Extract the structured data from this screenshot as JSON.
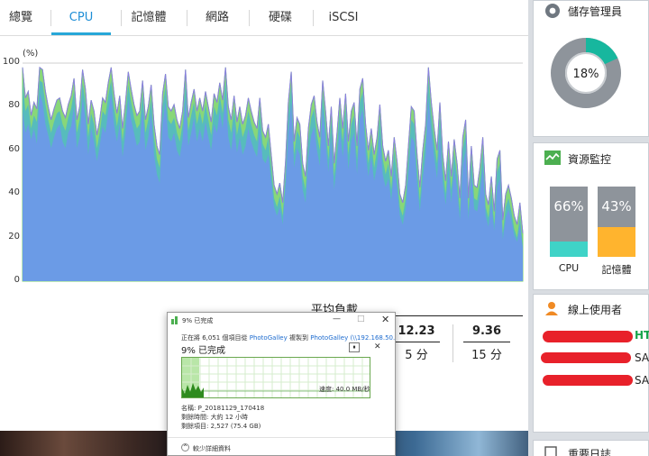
{
  "tabs": [
    {
      "label": "總覽",
      "active": false
    },
    {
      "label": "CPU",
      "active": true
    },
    {
      "label": "記憶體",
      "active": false
    },
    {
      "label": "網路",
      "active": false
    },
    {
      "label": "硬碟",
      "active": false
    },
    {
      "label": "iSCSI",
      "active": false
    }
  ],
  "chart": {
    "unit_label": "(%)",
    "y_ticks": [
      "0",
      "20",
      "40",
      "60",
      "80",
      "100"
    ],
    "colors": {
      "lower": "#6b9be6",
      "mid": "#4fb7c8",
      "top": "#7bd36a",
      "upper_stroke": "#8a7fe0"
    }
  },
  "chart_data": {
    "type": "area",
    "ylabel": "(%)",
    "ylim": [
      0,
      100
    ],
    "grid": false,
    "series": [
      {
        "values": [
          98,
          84,
          87,
          76,
          82,
          79,
          98,
          97,
          87,
          80,
          74,
          79,
          83,
          84,
          78,
          75,
          81,
          85,
          93,
          74,
          80,
          97,
          88,
          72,
          83,
          78,
          67,
          74,
          84,
          82,
          91,
          98,
          86,
          77,
          85,
          70,
          82,
          96,
          88,
          81,
          76,
          78,
          92,
          74,
          80,
          90,
          72,
          62,
          58,
          86,
          95,
          80,
          78,
          81,
          74,
          70,
          78,
          97,
          75,
          82,
          88,
          78,
          84,
          78,
          87,
          80,
          73,
          86,
          82,
          91,
          83,
          98,
          80,
          74,
          85,
          73,
          80,
          72,
          76,
          84,
          78,
          73,
          70,
          84,
          69,
          66,
          72,
          58,
          44,
          40,
          45,
          36,
          55,
          82,
          96,
          64,
          75,
          72,
          54,
          48,
          70,
          81,
          85,
          73,
          66,
          92,
          78,
          62,
          80,
          54,
          68,
          84,
          70,
          86,
          64,
          78,
          82,
          62,
          88,
          93,
          72,
          60,
          70,
          58,
          66,
          81,
          62,
          55,
          60,
          48,
          66,
          55,
          40,
          36,
          44,
          62,
          80,
          78,
          58,
          43,
          60,
          72,
          98,
          82,
          70,
          60,
          82,
          58,
          46,
          64,
          48,
          65,
          54,
          38,
          66,
          74,
          38,
          62,
          44,
          43,
          52,
          66,
          40,
          35,
          48,
          32,
          56,
          60,
          28,
          40,
          44,
          38,
          30,
          26,
          36,
          22
        ]
      },
      {
        "values": [
          78,
          68,
          72,
          65,
          70,
          63,
          86,
          82,
          72,
          67,
          61,
          66,
          70,
          72,
          64,
          61,
          68,
          71,
          80,
          61,
          66,
          84,
          74,
          58,
          70,
          64,
          55,
          62,
          71,
          68,
          78,
          86,
          72,
          64,
          72,
          57,
          68,
          83,
          74,
          68,
          62,
          64,
          79,
          60,
          66,
          77,
          58,
          49,
          45,
          72,
          82,
          66,
          64,
          68,
          60,
          57,
          65,
          84,
          62,
          68,
          75,
          64,
          70,
          64,
          73,
          66,
          60,
          72,
          68,
          78,
          70,
          85,
          66,
          60,
          72,
          59,
          66,
          58,
          62,
          70,
          64,
          60,
          57,
          70,
          56,
          54,
          58,
          46,
          34,
          30,
          34,
          26,
          44,
          68,
          82,
          52,
          61,
          58,
          42,
          36,
          57,
          67,
          71,
          60,
          53,
          79,
          64,
          50,
          66,
          42,
          55,
          70,
          57,
          72,
          51,
          64,
          68,
          49,
          74,
          79,
          59,
          48,
          57,
          46,
          53,
          67,
          49,
          43,
          47,
          37,
          52,
          43,
          30,
          26,
          33,
          49,
          66,
          64,
          45,
          32,
          47,
          58,
          84,
          68,
          57,
          47,
          68,
          45,
          35,
          51,
          36,
          52,
          42,
          28,
          53,
          60,
          28,
          49,
          33,
          32,
          40,
          52,
          30,
          25,
          36,
          23,
          43,
          47,
          19,
          29,
          33,
          28,
          21,
          18,
          26,
          15
        ]
      }
    ]
  },
  "average_load": {
    "title": "平均負載",
    "values": [
      {
        "value": "12.23",
        "label": "5 分"
      },
      {
        "value": "9.36",
        "label": "15 分"
      }
    ]
  },
  "right_panel": {
    "storage": {
      "title": "儲存管理員",
      "percent": "18%",
      "color": "#17b79e"
    },
    "monitor": {
      "title": "資源監控",
      "bars": [
        {
          "label": "CPU",
          "percent": "66%",
          "fill": 0.22,
          "color": "#3fd3c7"
        },
        {
          "label": "記憶體",
          "percent": "43%",
          "fill": 0.42,
          "color": "#ffb42e"
        }
      ]
    },
    "online_users": {
      "title": "線上使用者",
      "rows": [
        "HTT",
        "SAM",
        "SAM"
      ]
    },
    "bottom_title": "重要日誌"
  },
  "dialog": {
    "title": "9% 已完成",
    "copy_prefix": "正在將 6,051 個項目從",
    "copy_from": "PhotoGalley",
    "copy_mid": "複製到",
    "copy_to": "PhotoGalley (\\\\192.168.50...",
    "progress_text": "9% 已完成",
    "progress": 0.09,
    "speed": "速度: 40.0 MB/秒",
    "name_line": "名稱: P_20181129_170418",
    "time_line": "剩餘時間: 大約 12 小時",
    "items_line": "剩餘項目: 2,527 (75.4 GB)",
    "fewer_details": "較少詳細資料"
  }
}
